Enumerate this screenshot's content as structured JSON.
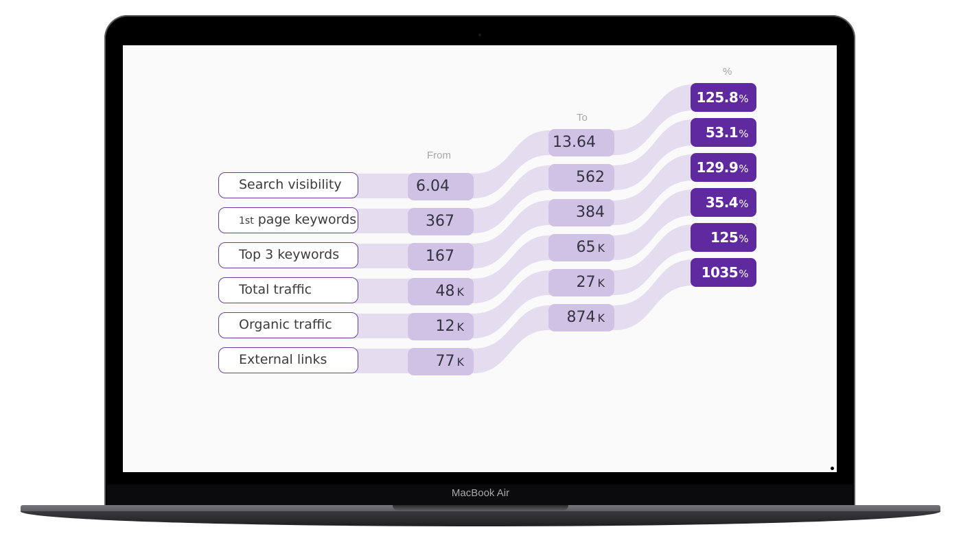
{
  "device": {
    "label": "MacBook Air"
  },
  "table": {
    "headers": {
      "from": "From",
      "to": "To",
      "change": "%"
    },
    "rows": [
      {
        "label_main": "Search visibility",
        "label_sup": "",
        "from": "6.04",
        "from_unit": "",
        "to": "13.64",
        "to_unit": "",
        "change": "125.8",
        "change_unit": "%"
      },
      {
        "label_main": " page keywords",
        "label_sup": "1st",
        "from": "367",
        "from_unit": "",
        "to": "562",
        "to_unit": "",
        "change": "53.1",
        "change_unit": "%"
      },
      {
        "label_main": "Top 3 keywords",
        "label_sup": "",
        "from": "167",
        "from_unit": "",
        "to": "384",
        "to_unit": "",
        "change": "129.9",
        "change_unit": "%"
      },
      {
        "label_main": "Total traffic",
        "label_sup": "",
        "from": "48",
        "from_unit": "K",
        "to": "65",
        "to_unit": "K",
        "change": "35.4",
        "change_unit": "%"
      },
      {
        "label_main": "Organic traffic",
        "label_sup": "",
        "from": "12",
        "from_unit": "K",
        "to": "27",
        "to_unit": "K",
        "change": "125",
        "change_unit": "%"
      },
      {
        "label_main": "External links",
        "label_sup": "",
        "from": "77",
        "from_unit": "K",
        "to": "874",
        "to_unit": "K",
        "change": "1035",
        "change_unit": "%"
      }
    ]
  },
  "colors": {
    "ribbon": "#e4dcef",
    "value_box": "#d0c2e4",
    "percent_box": "#5f2aa0",
    "label_border": "#6b3d9a"
  }
}
